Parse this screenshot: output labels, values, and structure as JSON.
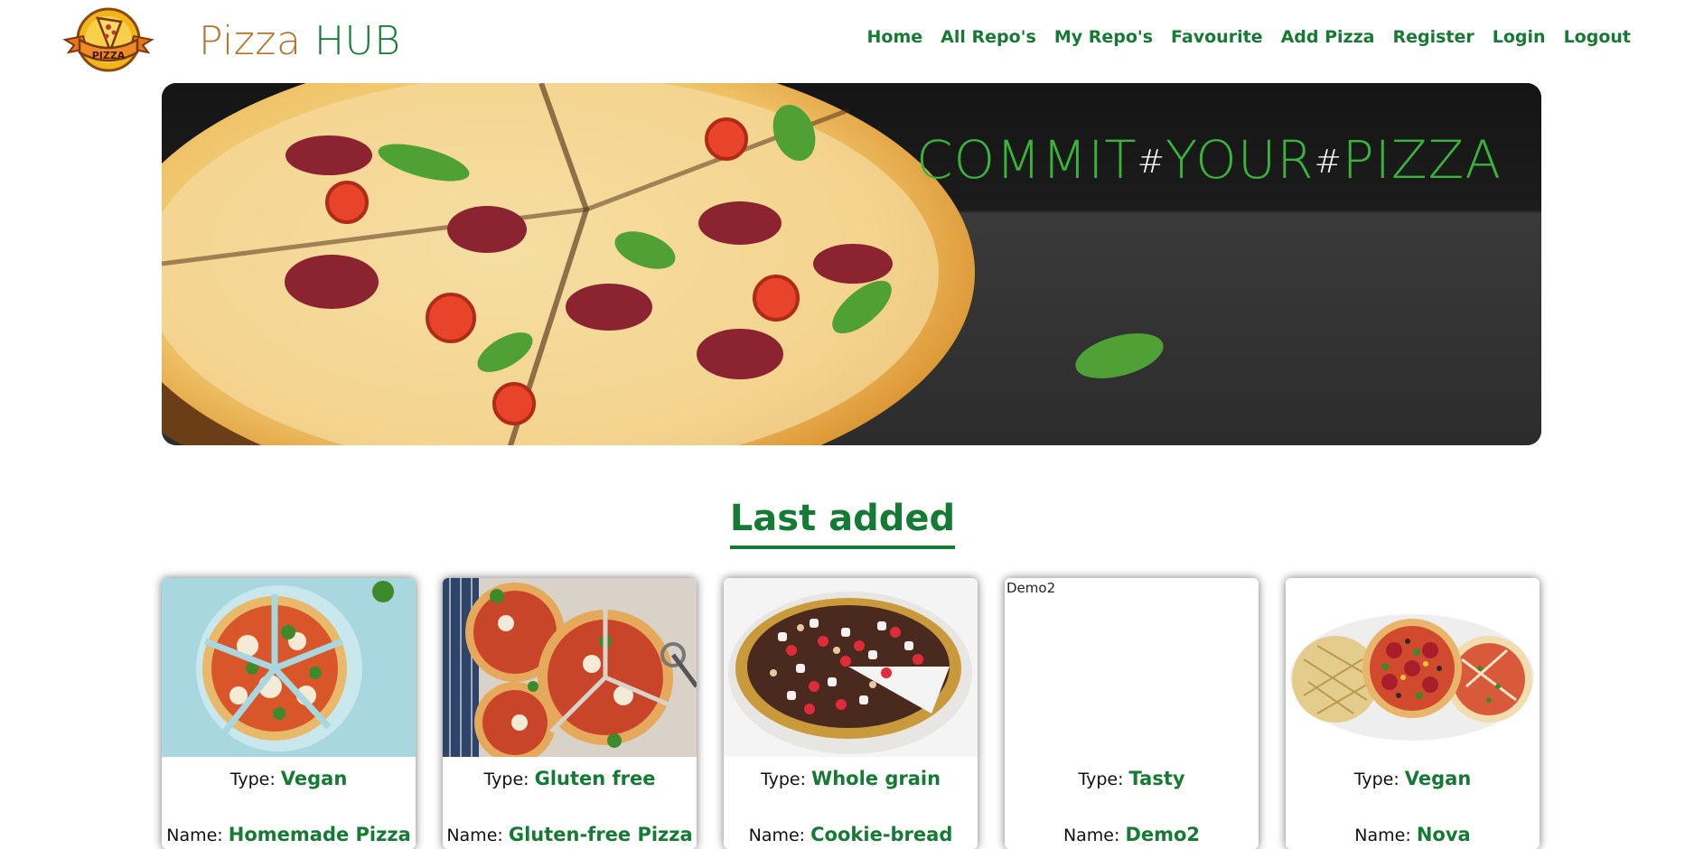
{
  "header": {
    "brand_part1": "Pizza",
    "brand_part2": " HUB",
    "logo_text": "PIZZA",
    "nav": [
      {
        "label": "Home"
      },
      {
        "label": "All Repo's"
      },
      {
        "label": "My Repo's"
      },
      {
        "label": "Favourite"
      },
      {
        "label": "Add Pizza"
      },
      {
        "label": "Register"
      },
      {
        "label": "Login"
      },
      {
        "label": "Logout"
      }
    ]
  },
  "hero": {
    "word1": "COMMIT",
    "hash1": "#",
    "word2": "YOUR",
    "hash2": "#",
    "word3": "PIZZA"
  },
  "section": {
    "title": "Last added"
  },
  "cards": [
    {
      "type_label": "Type:",
      "type_value": "Vegan",
      "name_label": "Name:",
      "name_value": "Homemade Pizza",
      "image": "vegan-pizza"
    },
    {
      "type_label": "Type:",
      "type_value": "Gluten free",
      "name_label": "Name:",
      "name_value": "Gluten-free Pizza",
      "image": "gluten-free-pizza"
    },
    {
      "type_label": "Type:",
      "type_value": "Whole grain",
      "name_label": "Name:",
      "name_value": "Cookie-bread",
      "image": "dessert-pizza"
    },
    {
      "type_label": "Type:",
      "type_value": "Tasty",
      "name_label": "Name:",
      "name_value": "Demo2",
      "image_alt": "Demo2",
      "image": "broken"
    },
    {
      "type_label": "Type:",
      "type_value": "Vegan",
      "name_label": "Name:",
      "name_value": "Nova",
      "image": "three-pizzas"
    }
  ],
  "colors": {
    "brand_green": "#157a33",
    "brand_orange": "#b8732a",
    "hero_green": "#39b43a"
  }
}
